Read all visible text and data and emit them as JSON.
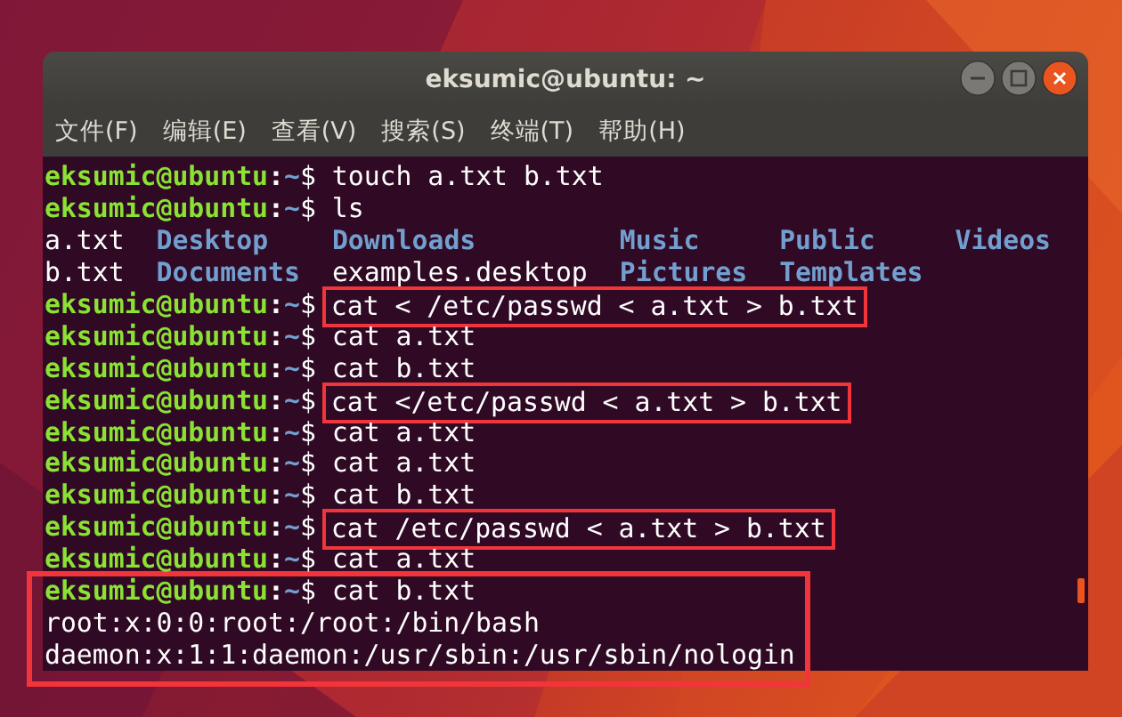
{
  "window": {
    "title": "eksumic@ubuntu: ~",
    "controls": [
      {
        "kind": "minimize"
      },
      {
        "kind": "maximize"
      },
      {
        "kind": "close"
      }
    ]
  },
  "menu": [
    {
      "label": "文件(F)"
    },
    {
      "label": "编辑(E)"
    },
    {
      "label": "查看(V)"
    },
    {
      "label": "搜索(S)"
    },
    {
      "label": "终端(T)"
    },
    {
      "label": "帮助(H)"
    }
  ],
  "terminal": {
    "lines": [
      {
        "kind": "prompt",
        "user_host": "eksumic@ubuntu",
        "separator": ":",
        "cwd": "~",
        "symbol": "$",
        "command": "touch a.txt b.txt",
        "highlighted": false
      },
      {
        "kind": "prompt",
        "user_host": "eksumic@ubuntu",
        "separator": ":",
        "cwd": "~",
        "symbol": "$",
        "command": "ls",
        "highlighted": false
      },
      {
        "kind": "listing",
        "entries": [
          {
            "text": "a.txt",
            "kind": "file"
          },
          {
            "text": "Desktop",
            "kind": "dir"
          },
          {
            "text": "Downloads",
            "kind": "dir"
          },
          {
            "text": "Music",
            "kind": "dir"
          },
          {
            "text": "Public",
            "kind": "dir"
          },
          {
            "text": "Videos",
            "kind": "dir"
          }
        ]
      },
      {
        "kind": "listing",
        "entries": [
          {
            "text": "b.txt",
            "kind": "file"
          },
          {
            "text": "Documents",
            "kind": "dir"
          },
          {
            "text": "examples.desktop",
            "kind": "file"
          },
          {
            "text": "Pictures",
            "kind": "dir"
          },
          {
            "text": "Templates",
            "kind": "dir"
          }
        ]
      },
      {
        "kind": "prompt",
        "user_host": "eksumic@ubuntu",
        "separator": ":",
        "cwd": "~",
        "symbol": "$",
        "command": "cat < /etc/passwd < a.txt > b.txt",
        "highlighted": true
      },
      {
        "kind": "prompt",
        "user_host": "eksumic@ubuntu",
        "separator": ":",
        "cwd": "~",
        "symbol": "$",
        "command": "cat a.txt",
        "highlighted": false
      },
      {
        "kind": "prompt",
        "user_host": "eksumic@ubuntu",
        "separator": ":",
        "cwd": "~",
        "symbol": "$",
        "command": "cat b.txt",
        "highlighted": false
      },
      {
        "kind": "prompt",
        "user_host": "eksumic@ubuntu",
        "separator": ":",
        "cwd": "~",
        "symbol": "$",
        "command": "cat </etc/passwd < a.txt > b.txt",
        "highlighted": true
      },
      {
        "kind": "prompt",
        "user_host": "eksumic@ubuntu",
        "separator": ":",
        "cwd": "~",
        "symbol": "$",
        "command": "cat a.txt",
        "highlighted": false
      },
      {
        "kind": "prompt",
        "user_host": "eksumic@ubuntu",
        "separator": ":",
        "cwd": "~",
        "symbol": "$",
        "command": "cat a.txt",
        "highlighted": false
      },
      {
        "kind": "prompt",
        "user_host": "eksumic@ubuntu",
        "separator": ":",
        "cwd": "~",
        "symbol": "$",
        "command": "cat b.txt",
        "highlighted": false
      },
      {
        "kind": "prompt",
        "user_host": "eksumic@ubuntu",
        "separator": ":",
        "cwd": "~",
        "symbol": "$",
        "command": "cat /etc/passwd < a.txt > b.txt",
        "highlighted": true
      },
      {
        "kind": "prompt",
        "user_host": "eksumic@ubuntu",
        "separator": ":",
        "cwd": "~",
        "symbol": "$",
        "command": "cat a.txt",
        "highlighted": false
      }
    ],
    "highlighted_block": {
      "lines": [
        {
          "kind": "prompt",
          "user_host": "eksumic@ubuntu",
          "separator": ":",
          "cwd": "~",
          "symbol": "$",
          "command": "cat b.txt",
          "highlighted": false
        },
        {
          "kind": "output",
          "text": "root:x:0:0:root:/root:/bin/bash"
        },
        {
          "kind": "output",
          "text": "daemon:x:1:1:daemon:/usr/sbin:/usr/sbin/nologin"
        }
      ]
    }
  }
}
